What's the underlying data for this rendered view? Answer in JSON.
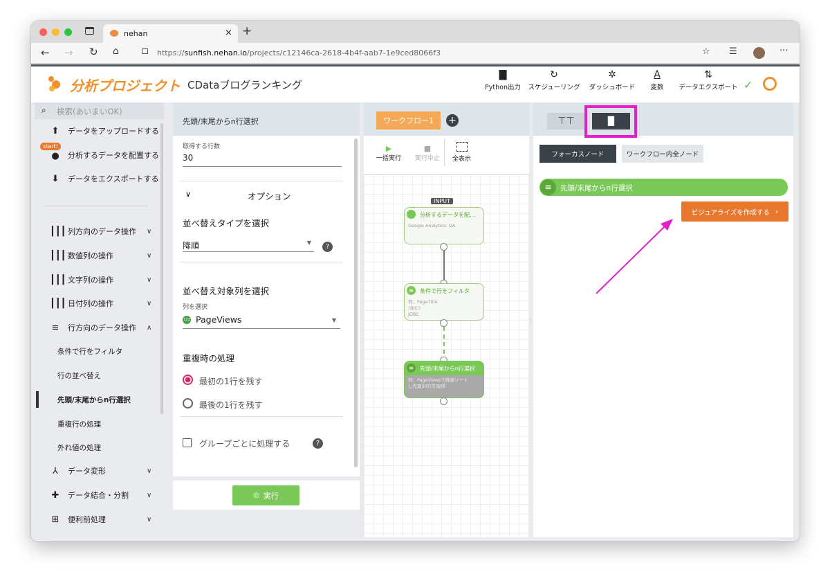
{
  "browser": {
    "tab_title": "nehan",
    "url_prefix": "https://",
    "url_host": "sunfish.nehan.io",
    "url_path": "/projects/c12146ca-2618-4b4f-aab7-1e9ced8066f3"
  },
  "app": {
    "section_title": "分析プロジェクト",
    "project_name": "CDataブログランキング",
    "toolbar": [
      {
        "icon": "file-icon",
        "label": "Python出力"
      },
      {
        "icon": "schedule-icon",
        "label": "スケジューリング"
      },
      {
        "icon": "dashboard-icon",
        "label": "ダッシュボード"
      },
      {
        "icon": "variable-icon",
        "label": "変数"
      },
      {
        "icon": "export-icon",
        "label": "データエクスポート"
      }
    ]
  },
  "sidebar": {
    "search_placeholder": "検索(あいまいOK)",
    "top_items": [
      {
        "icon": "upload-icon",
        "label": "データをアップロードする"
      },
      {
        "icon": "place-data-icon",
        "label": "分析するデータを配置する",
        "badge": "start!"
      },
      {
        "icon": "export-data-icon",
        "label": "データをエクスポートする"
      }
    ],
    "categories": [
      {
        "label": "列方向のデータ操作",
        "chevron": "∨"
      },
      {
        "label": "数値列の操作",
        "chevron": "∨"
      },
      {
        "label": "文字列の操作",
        "chevron": "∨"
      },
      {
        "label": "日付列の操作",
        "chevron": "∨"
      },
      {
        "label": "行方向のデータ操作",
        "chevron": "∧"
      }
    ],
    "sub_items": [
      "条件で行をフィルタ",
      "行の並べ替え",
      "先頭/末尾からn行選択",
      "重複行の処理",
      "外れ値の処理"
    ],
    "bottom_categories": [
      {
        "label": "データ変形",
        "chevron": "∨"
      },
      {
        "label": "データ結合・分割",
        "chevron": "∨"
      },
      {
        "label": "便利前処理",
        "chevron": "∨"
      }
    ]
  },
  "settings": {
    "title": "先頭/末尾からn行選択",
    "rows_label": "取得する行数",
    "rows_value": "30",
    "options_label": "オプション",
    "sort_type_heading": "並べ替えタイプを選択",
    "sort_type_value": "降順",
    "sort_col_heading": "並べ替え対象列を選択",
    "col_select_label": "列を選択",
    "col_type_badge": "123",
    "col_value": "PageViews",
    "dup_heading": "重複時の処理",
    "radio_first": "最初の1行を残す",
    "radio_last": "最後の1行を残す",
    "group_checkbox": "グループごとに処理する",
    "help_icon": "?",
    "run_label": "実行"
  },
  "workflow": {
    "tab_label": "ワークフロー1",
    "run_all": "一括実行",
    "stop": "実行中止",
    "fit_all": "全表示",
    "input_badge": "INPUT",
    "nodes": [
      {
        "title": "分析するデータを配...",
        "body": [
          "Google Analytics: GA"
        ]
      },
      {
        "title": "条件で行をフィルタ",
        "body": [
          "列：PageTitle",
          "(含む)",
          "JDBC"
        ]
      },
      {
        "title": "先頭/末尾からn行選択",
        "body": [
          "列：PageViewsで降順ソート",
          "し先頭30行を取得"
        ]
      }
    ]
  },
  "viz": {
    "focus_node_btn": "フォーカスノード",
    "all_nodes_btn": "ワークフロー内全ノード",
    "node_label": "先頭/末尾からn行選択",
    "create_viz_btn": "ビジュアライズを作成する",
    "accent_orange": "#e8782e",
    "accent_green": "#7ac857",
    "highlight_magenta": "#e620c9"
  }
}
